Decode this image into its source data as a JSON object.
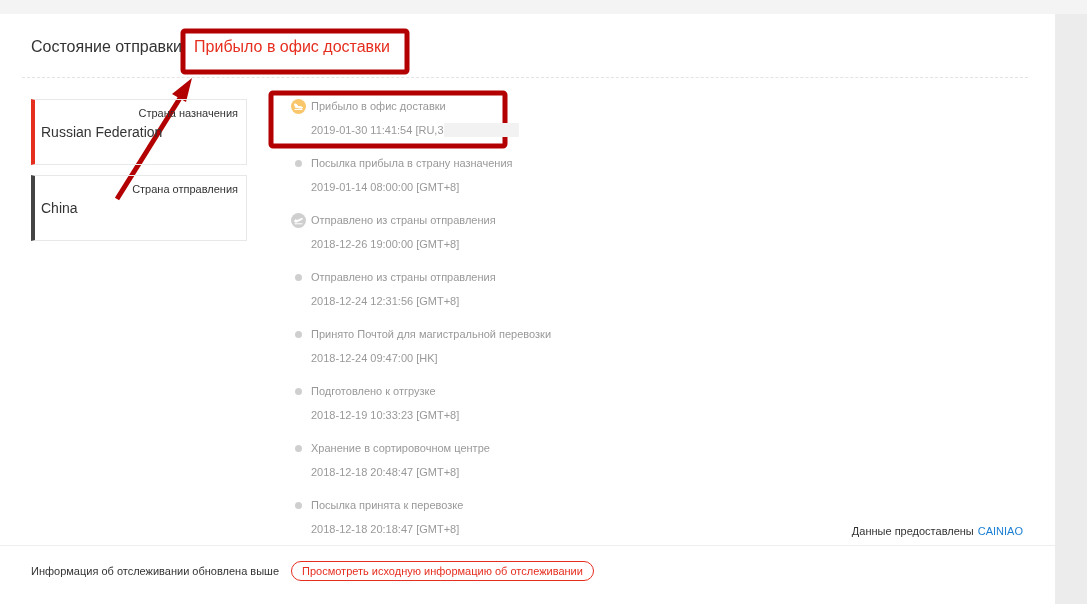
{
  "header": {
    "label": "Состояние отправки",
    "status": "Прибыло в офис доставки"
  },
  "countries": [
    {
      "label": "Страна назначения",
      "value": "Russian Federation",
      "kind": "destination"
    },
    {
      "label": "Страна отправления",
      "value": "China",
      "kind": "origin"
    }
  ],
  "events": [
    {
      "title": "Прибыло в офис доставки",
      "time": "2019-01-30 11:41:54 [RU,3",
      "kind": "landing",
      "redacted": true
    },
    {
      "title": "Посылка прибыла в страну назначения",
      "time": "2019-01-14 08:00:00 [GMT+8]",
      "kind": "dot"
    },
    {
      "title": "Отправлено из страны отправления",
      "time": "2018-12-26 19:00:00 [GMT+8]",
      "kind": "takeoff"
    },
    {
      "title": "Отправлено из страны отправления",
      "time": "2018-12-24 12:31:56 [GMT+8]",
      "kind": "dot"
    },
    {
      "title": "Принято Почтой для магистральной перевозки",
      "time": "2018-12-24 09:47:00 [HK]",
      "kind": "dot"
    },
    {
      "title": "Подготовлено к отгрузке",
      "time": "2018-12-19 10:33:23 [GMT+8]",
      "kind": "dot"
    },
    {
      "title": "Хранение в сортировочном центре",
      "time": "2018-12-18 20:48:47 [GMT+8]",
      "kind": "dot"
    },
    {
      "title": "Посылка принята к перевозке",
      "time": "2018-12-18 20:18:47 [GMT+8]",
      "kind": "dot"
    }
  ],
  "provider": {
    "label": "Данные предоставлены",
    "link": "CAINIAO"
  },
  "footer": {
    "note": "Информация об отслеживании обновлена выше",
    "button": "Просмотреть исходную информацию об отслеживании"
  }
}
